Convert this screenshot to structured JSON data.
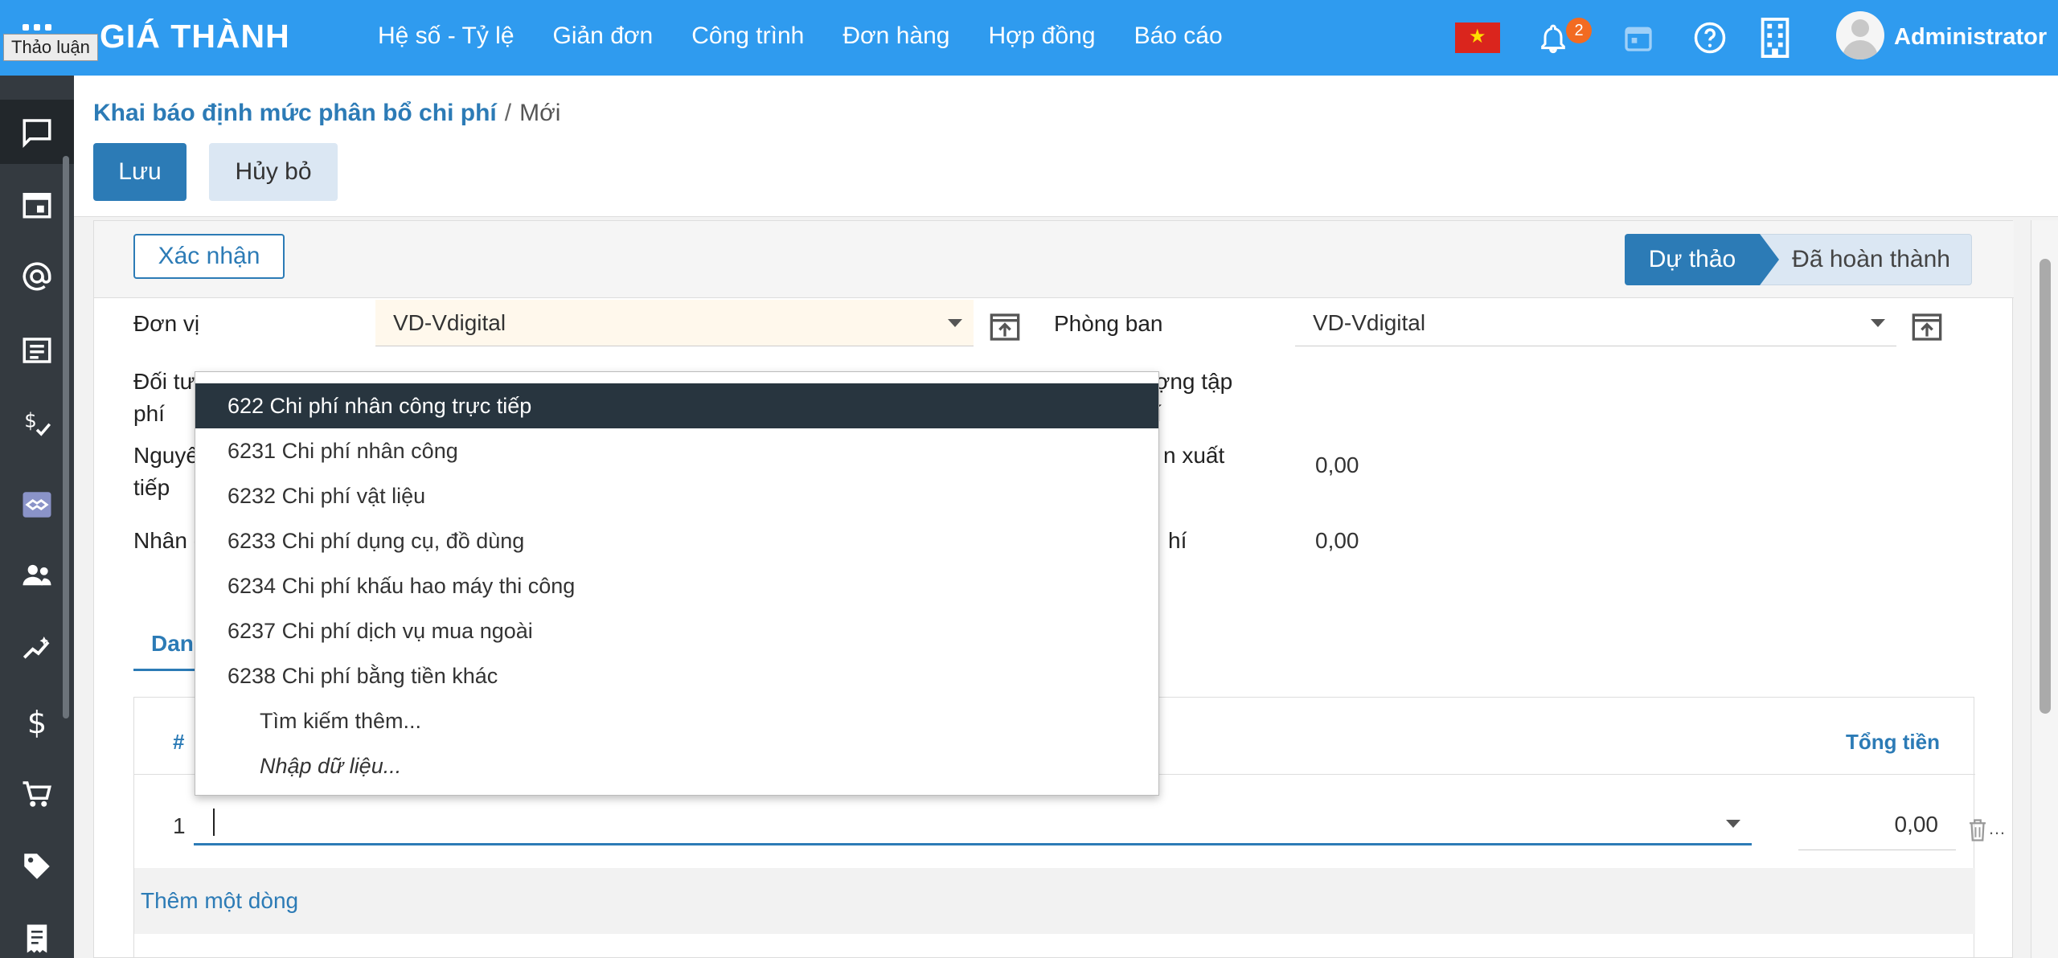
{
  "tooltip": "Thảo luận",
  "navbar": {
    "brand": "GIÁ THÀNH",
    "menu": [
      "Hệ số - Tỷ lệ",
      "Giản đơn",
      "Công trình",
      "Đơn hàng",
      "Hợp đồng",
      "Báo cáo"
    ],
    "notification_count": "2",
    "user": "Administrator"
  },
  "breadcrumb": {
    "parent": "Khai báo định mức phân bổ chi phí",
    "separator": "/",
    "current": "Mới"
  },
  "buttons": {
    "save": "Lưu",
    "cancel": "Hủy bỏ",
    "confirm": "Xác nhận"
  },
  "stages": {
    "active": "Dự thảo",
    "next": "Đã hoàn thành"
  },
  "form": {
    "don_vi_label": "Đơn vị",
    "don_vi_value": "VD-Vdigital",
    "phong_ban_label": "Phòng ban",
    "phong_ban_value": "VD-Vdigital",
    "doi_tuong_label_1": "Đối tư",
    "doi_tuong_label_2": "phí",
    "nguyen_label_1": "Nguyê",
    "nguyen_label_2": "tiếp",
    "nhan_label": "Nhân c",
    "right_label_1a": "ợng tập",
    "right_label_1b": "í",
    "right_label_2": "n xuất",
    "right_value_2": "0,00",
    "right_label_3": "hí",
    "right_value_3": "0,00"
  },
  "tab": {
    "label": "Danh"
  },
  "table": {
    "col_num": "#",
    "col_total": "Tổng tiền",
    "rows": [
      {
        "index": "1",
        "total": "0,00"
      }
    ],
    "add_line": "Thêm một dòng"
  },
  "dropdown": {
    "items": [
      "622 Chi phí nhân công trực tiếp",
      "6231 Chi phí nhân công",
      "6232 Chi phí vật liệu",
      "6233 Chi phí dụng cụ, đồ dùng",
      "6234 Chi phí khấu hao máy thi công",
      "6237 Chi phí dịch vụ mua ngoài",
      "6238 Chi phí bằng tiền khác"
    ],
    "search_more": "Tìm kiếm thêm...",
    "import": "Nhập dữ liệu..."
  },
  "colors": {
    "navbar": "#2f9bef",
    "primary": "#2c7bb6",
    "sidebar": "#343a40",
    "dropdown_selected": "#28353f",
    "badge": "#f26b21"
  }
}
